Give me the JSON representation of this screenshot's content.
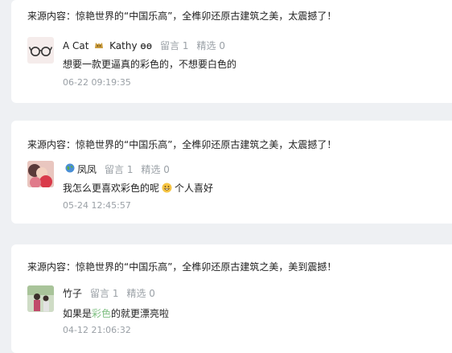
{
  "comments": [
    {
      "source": "来源内容：惊艳世界的“中国乐高”，全榫卯还原古建筑之美，太震撼了！",
      "name_prefix": "A Cat",
      "name_suffix": "Kathy",
      "name_tail": "ɵɵ",
      "replies": "留言 1",
      "featured": "精选 0",
      "text": "想要一款更逼真的彩色的，不想要白色的",
      "time": "06-22 09:19:35"
    },
    {
      "source": "来源内容：惊艳世界的“中国乐高”，全榫卯还原古建筑之美，太震撼了！",
      "name": "凤凤",
      "replies": "留言 1",
      "featured": "精选 0",
      "text_before": "我怎么更喜欢彩色的呢",
      "text_after": "个人喜好",
      "time": "05-24 12:45:57"
    },
    {
      "source": "来源内容：惊艳世界的“中国乐高”，全榫卯还原古建筑之美，美到震撼！",
      "name": "竹子",
      "replies": "留言 1",
      "featured": "精选 0",
      "text_before": "如果是",
      "text_highlight": "彩色",
      "text_after": "的就更漂亮啦",
      "time": "04-12 21:06:32"
    }
  ],
  "colors": {
    "background": "#eef0f3",
    "card": "#ffffff",
    "muted": "#9aa0a6",
    "highlight": "#7fbf82"
  }
}
